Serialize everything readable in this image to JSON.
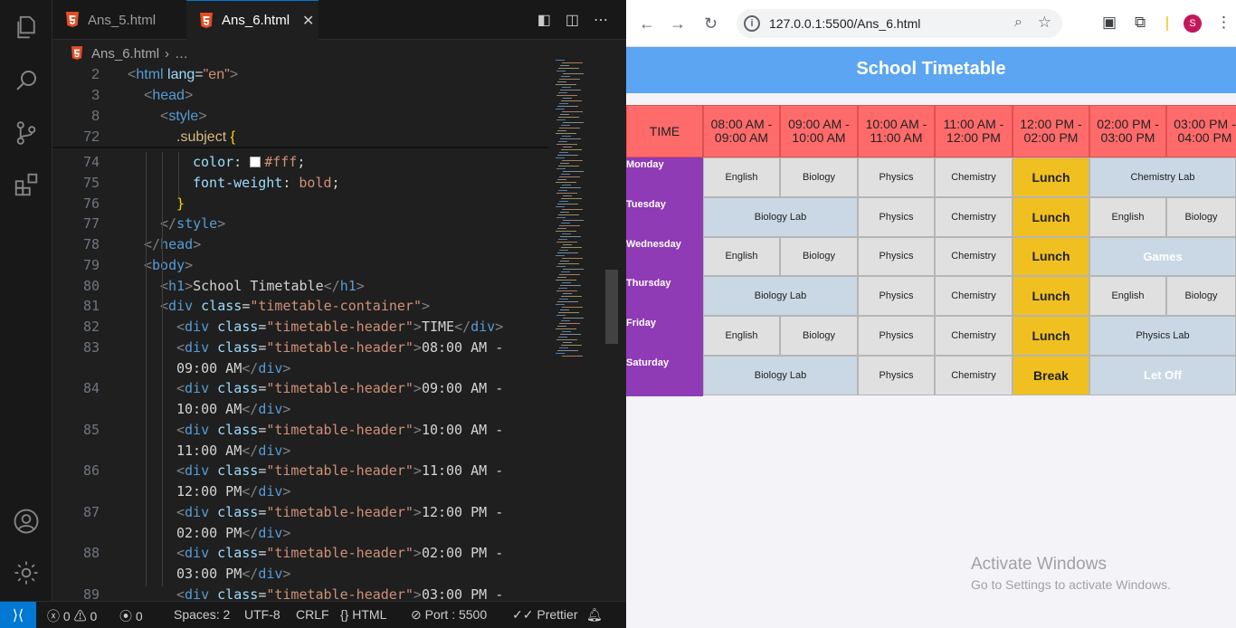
{
  "vscode": {
    "tabs": [
      {
        "label": "Ans_5.html",
        "active": false
      },
      {
        "label": "Ans_6.html",
        "active": true
      }
    ],
    "close_glyph": "✕",
    "breadcrumb": {
      "file": "Ans_6.html",
      "rest": "…"
    },
    "sticky_lines": [
      {
        "n": "2",
        "tokens": [
          [
            "br",
            "<"
          ],
          [
            "tg",
            "html"
          ],
          [
            "at",
            " lang"
          ],
          [
            "tx",
            "="
          ],
          [
            "st",
            "\"en\""
          ],
          [
            "br",
            ">"
          ]
        ],
        "indent": 0
      },
      {
        "n": "3",
        "tokens": [
          [
            "br",
            "<"
          ],
          [
            "tg",
            "head"
          ],
          [
            "br",
            ">"
          ]
        ],
        "indent": 1
      },
      {
        "n": "8",
        "tokens": [
          [
            "br",
            "<"
          ],
          [
            "tg",
            "style"
          ],
          [
            "br",
            ">"
          ]
        ],
        "indent": 2
      },
      {
        "n": "72",
        "tokens": [
          [
            "sel",
            ".subject"
          ],
          [
            "tx",
            " "
          ],
          [
            "yb",
            "{"
          ]
        ],
        "indent": 3
      }
    ],
    "lines": [
      {
        "n": "74",
        "tokens": [
          [
            "pr",
            "color"
          ],
          [
            "tx",
            ": "
          ],
          [
            "sw",
            ""
          ],
          [
            "st",
            "#fff"
          ],
          [
            "tx",
            ";"
          ]
        ],
        "indent": 4
      },
      {
        "n": "75",
        "tokens": [
          [
            "pr",
            "font-weight"
          ],
          [
            "tx",
            ": "
          ],
          [
            "st",
            "bold"
          ],
          [
            "tx",
            ";"
          ]
        ],
        "indent": 4
      },
      {
        "n": "76",
        "tokens": [
          [
            "yb",
            "}"
          ]
        ],
        "indent": 3
      },
      {
        "n": "77",
        "tokens": [
          [
            "br",
            "</"
          ],
          [
            "tg",
            "style"
          ],
          [
            "br",
            ">"
          ]
        ],
        "indent": 2
      },
      {
        "n": "78",
        "tokens": [
          [
            "br",
            "</"
          ],
          [
            "tg",
            "head"
          ],
          [
            "br",
            ">"
          ]
        ],
        "indent": 1
      },
      {
        "n": "79",
        "tokens": [
          [
            "br",
            "<"
          ],
          [
            "tg",
            "body"
          ],
          [
            "br",
            ">"
          ]
        ],
        "indent": 1
      },
      {
        "n": "80",
        "tokens": [
          [
            "br",
            "<"
          ],
          [
            "tg",
            "h1"
          ],
          [
            "br",
            ">"
          ],
          [
            "tx",
            "School Timetable"
          ],
          [
            "br",
            "</"
          ],
          [
            "tg",
            "h1"
          ],
          [
            "br",
            ">"
          ]
        ],
        "indent": 2
      },
      {
        "n": "81",
        "tokens": [
          [
            "br",
            "<"
          ],
          [
            "tg",
            "div"
          ],
          [
            "at",
            " class"
          ],
          [
            "tx",
            "="
          ],
          [
            "st",
            "\"timetable-container\""
          ],
          [
            "br",
            ">"
          ]
        ],
        "indent": 2
      },
      {
        "n": "82",
        "tokens": [
          [
            "br",
            "<"
          ],
          [
            "tg",
            "div"
          ],
          [
            "at",
            " class"
          ],
          [
            "tx",
            "="
          ],
          [
            "st",
            "\"timetable-header\""
          ],
          [
            "br",
            ">"
          ],
          [
            "tx",
            "TIME"
          ],
          [
            "br",
            "</"
          ],
          [
            "tg",
            "div"
          ],
          [
            "br",
            ">"
          ]
        ],
        "indent": 3
      },
      {
        "n": "83",
        "tokens": [
          [
            "br",
            "<"
          ],
          [
            "tg",
            "div"
          ],
          [
            "at",
            " class"
          ],
          [
            "tx",
            "="
          ],
          [
            "st",
            "\"timetable-header\""
          ],
          [
            "br",
            ">"
          ],
          [
            "tx",
            "08:00 AM -"
          ]
        ],
        "indent": 3
      },
      {
        "n": "",
        "tokens": [
          [
            "tx",
            "09:00 AM"
          ],
          [
            "br",
            "</"
          ],
          [
            "tg",
            "div"
          ],
          [
            "br",
            ">"
          ]
        ],
        "indent": 3
      },
      {
        "n": "84",
        "tokens": [
          [
            "br",
            "<"
          ],
          [
            "tg",
            "div"
          ],
          [
            "at",
            " class"
          ],
          [
            "tx",
            "="
          ],
          [
            "st",
            "\"timetable-header\""
          ],
          [
            "br",
            ">"
          ],
          [
            "tx",
            "09:00 AM -"
          ]
        ],
        "indent": 3
      },
      {
        "n": "",
        "tokens": [
          [
            "tx",
            "10:00 AM"
          ],
          [
            "br",
            "</"
          ],
          [
            "tg",
            "div"
          ],
          [
            "br",
            ">"
          ]
        ],
        "indent": 3
      },
      {
        "n": "85",
        "tokens": [
          [
            "br",
            "<"
          ],
          [
            "tg",
            "div"
          ],
          [
            "at",
            " class"
          ],
          [
            "tx",
            "="
          ],
          [
            "st",
            "\"timetable-header\""
          ],
          [
            "br",
            ">"
          ],
          [
            "tx",
            "10:00 AM -"
          ]
        ],
        "indent": 3
      },
      {
        "n": "",
        "tokens": [
          [
            "tx",
            "11:00 AM"
          ],
          [
            "br",
            "</"
          ],
          [
            "tg",
            "div"
          ],
          [
            "br",
            ">"
          ]
        ],
        "indent": 3
      },
      {
        "n": "86",
        "tokens": [
          [
            "br",
            "<"
          ],
          [
            "tg",
            "div"
          ],
          [
            "at",
            " class"
          ],
          [
            "tx",
            "="
          ],
          [
            "st",
            "\"timetable-header\""
          ],
          [
            "br",
            ">"
          ],
          [
            "tx",
            "11:00 AM -"
          ]
        ],
        "indent": 3
      },
      {
        "n": "",
        "tokens": [
          [
            "tx",
            "12:00 PM"
          ],
          [
            "br",
            "</"
          ],
          [
            "tg",
            "div"
          ],
          [
            "br",
            ">"
          ]
        ],
        "indent": 3
      },
      {
        "n": "87",
        "tokens": [
          [
            "br",
            "<"
          ],
          [
            "tg",
            "div"
          ],
          [
            "at",
            " class"
          ],
          [
            "tx",
            "="
          ],
          [
            "st",
            "\"timetable-header\""
          ],
          [
            "br",
            ">"
          ],
          [
            "tx",
            "12:00 PM -"
          ]
        ],
        "indent": 3
      },
      {
        "n": "",
        "tokens": [
          [
            "tx",
            "02:00 PM"
          ],
          [
            "br",
            "</"
          ],
          [
            "tg",
            "div"
          ],
          [
            "br",
            ">"
          ]
        ],
        "indent": 3
      },
      {
        "n": "88",
        "tokens": [
          [
            "br",
            "<"
          ],
          [
            "tg",
            "div"
          ],
          [
            "at",
            " class"
          ],
          [
            "tx",
            "="
          ],
          [
            "st",
            "\"timetable-header\""
          ],
          [
            "br",
            ">"
          ],
          [
            "tx",
            "02:00 PM -"
          ]
        ],
        "indent": 3
      },
      {
        "n": "",
        "tokens": [
          [
            "tx",
            "03:00 PM"
          ],
          [
            "br",
            "</"
          ],
          [
            "tg",
            "div"
          ],
          [
            "br",
            ">"
          ]
        ],
        "indent": 3
      },
      {
        "n": "89",
        "tokens": [
          [
            "br",
            "<"
          ],
          [
            "tg",
            "div"
          ],
          [
            "at",
            " class"
          ],
          [
            "tx",
            "="
          ],
          [
            "st",
            "\"timetable-header\""
          ],
          [
            "br",
            ">"
          ],
          [
            "tx",
            "03:00 PM -"
          ]
        ],
        "indent": 3
      }
    ],
    "status": {
      "errors": "0",
      "warnings": "0",
      "ports": "0",
      "spaces": "Spaces: 2",
      "encoding": "UTF-8",
      "eol": "CRLF",
      "language": "HTML",
      "port": "Port : 5500",
      "formatter": "Prettier"
    }
  },
  "browser": {
    "url": "127.0.0.1:5500/Ans_6.html",
    "profile_initial": "S",
    "page_title": "School Timetable",
    "headers": [
      "TIME",
      "08:00 AM - 09:00 AM",
      "09:00 AM - 10:00 AM",
      "10:00 AM - 11:00 AM",
      "11:00 AM - 12:00 PM",
      "12:00 PM - 02:00 PM",
      "02:00 PM - 03:00 PM",
      "03:00 PM - 04:00 PM"
    ],
    "rows": [
      {
        "day": "Monday",
        "cells": [
          {
            "text": "English",
            "span": 1,
            "style": "light"
          },
          {
            "text": "Biology",
            "span": 1,
            "style": "light"
          },
          {
            "text": "Physics",
            "span": 1,
            "style": "light"
          },
          {
            "text": "Chemistry",
            "span": 1,
            "style": "light"
          },
          {
            "text": "Lunch",
            "span": 1,
            "style": "lunch"
          },
          {
            "text": "Chemistry Lab",
            "span": 2,
            "style": "blue"
          }
        ]
      },
      {
        "day": "Tuesday",
        "cells": [
          {
            "text": "Biology Lab",
            "span": 2,
            "style": "blue"
          },
          {
            "text": "Physics",
            "span": 1,
            "style": "light"
          },
          {
            "text": "Chemistry",
            "span": 1,
            "style": "light"
          },
          {
            "text": "Lunch",
            "span": 1,
            "style": "lunch"
          },
          {
            "text": "English",
            "span": 1,
            "style": "light"
          },
          {
            "text": "Biology",
            "span": 1,
            "style": "light"
          }
        ]
      },
      {
        "day": "Wednesday",
        "cells": [
          {
            "text": "English",
            "span": 1,
            "style": "light"
          },
          {
            "text": "Biology",
            "span": 1,
            "style": "light"
          },
          {
            "text": "Physics",
            "span": 1,
            "style": "light"
          },
          {
            "text": "Chemistry",
            "span": 1,
            "style": "light"
          },
          {
            "text": "Lunch",
            "span": 1,
            "style": "lunch"
          },
          {
            "text": "Games",
            "span": 2,
            "style": "bluebold"
          }
        ]
      },
      {
        "day": "Thursday",
        "cells": [
          {
            "text": "Biology Lab",
            "span": 2,
            "style": "blue"
          },
          {
            "text": "Physics",
            "span": 1,
            "style": "light"
          },
          {
            "text": "Chemistry",
            "span": 1,
            "style": "light"
          },
          {
            "text": "Lunch",
            "span": 1,
            "style": "lunch"
          },
          {
            "text": "English",
            "span": 1,
            "style": "light"
          },
          {
            "text": "Biology",
            "span": 1,
            "style": "light"
          }
        ]
      },
      {
        "day": "Friday",
        "cells": [
          {
            "text": "English",
            "span": 1,
            "style": "light"
          },
          {
            "text": "Biology",
            "span": 1,
            "style": "light"
          },
          {
            "text": "Physics",
            "span": 1,
            "style": "light"
          },
          {
            "text": "Chemistry",
            "span": 1,
            "style": "light"
          },
          {
            "text": "Lunch",
            "span": 1,
            "style": "lunch"
          },
          {
            "text": "Physics Lab",
            "span": 2,
            "style": "blue"
          }
        ]
      },
      {
        "day": "Saturday",
        "cells": [
          {
            "text": "Biology Lab",
            "span": 2,
            "style": "blue"
          },
          {
            "text": "Physics",
            "span": 1,
            "style": "light"
          },
          {
            "text": "Chemistry",
            "span": 1,
            "style": "light"
          },
          {
            "text": "Break",
            "span": 1,
            "style": "lunch"
          },
          {
            "text": "Let Off",
            "span": 2,
            "style": "bluebold"
          }
        ]
      }
    ],
    "watermark": {
      "title": "Activate Windows",
      "subtitle": "Go to Settings to activate Windows."
    }
  },
  "colors": {
    "header_bg": "#ff6b6b",
    "day_bg": "#8e3bb5",
    "lunch_bg": "#f0c020",
    "banner_bg": "#5ba5f2",
    "accent": "#0078d4"
  },
  "icons": [
    "explorer-icon",
    "search-icon",
    "source-control-icon",
    "extensions-icon",
    "account-icon",
    "settings-gear-icon",
    "html5-icon",
    "close-icon",
    "split-editor-icon",
    "more-icon",
    "remote-icon",
    "error-icon",
    "warning-icon",
    "broadcast-icon",
    "braces-icon",
    "port-icon",
    "bell-icon",
    "back-icon",
    "forward-icon",
    "reload-icon",
    "site-info-icon",
    "zoom-icon",
    "star-icon",
    "extensions-puzzle-icon",
    "profile-avatar"
  ]
}
